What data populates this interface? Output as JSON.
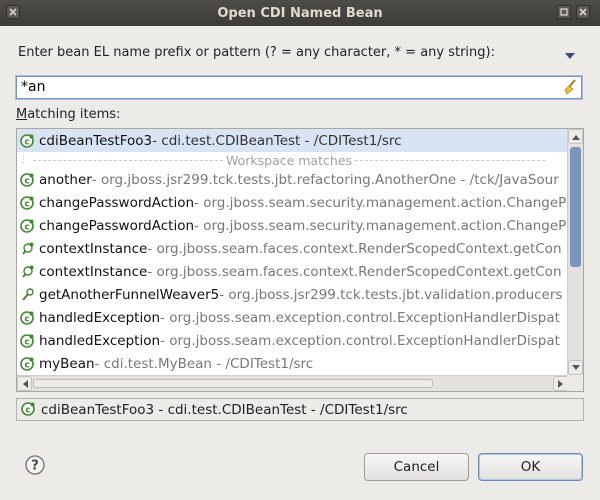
{
  "window": {
    "title": "Open CDI Named Bean"
  },
  "prompt": {
    "label": "Enter bean EL name prefix or pattern (? = any character, * = any string):"
  },
  "search": {
    "value": "*an"
  },
  "matching": {
    "mnemonic": "M",
    "label_rest": "atching items:"
  },
  "list": {
    "selected": {
      "name": "cdiBeanTestFoo3",
      "detail": " - cdi.test.CDIBeanTest - /CDITest1/src"
    },
    "separator": "Workspace matches",
    "items": [
      {
        "name": "another",
        "detail": " - org.jboss.jsr299.tck.tests.jbt.refactoring.AnotherOne - /tck/JavaSour"
      },
      {
        "name": "changePasswordAction",
        "detail": " - org.jboss.seam.security.management.action.ChangeP"
      },
      {
        "name": "changePasswordAction",
        "detail": " - org.jboss.seam.security.management.action.ChangeP"
      },
      {
        "name": "contextInstance",
        "detail": " - org.jboss.seam.faces.context.RenderScopedContext.getCon"
      },
      {
        "name": "contextInstance",
        "detail": " - org.jboss.seam.faces.context.RenderScopedContext.getCon"
      },
      {
        "name": "getAnotherFunnelWeaver5",
        "detail": " - org.jboss.jsr299.tck.tests.jbt.validation.producers"
      },
      {
        "name": "handledException",
        "detail": " - org.jboss.seam.exception.control.ExceptionHandlerDispat"
      },
      {
        "name": "handledException",
        "detail": " - org.jboss.seam.exception.control.ExceptionHandlerDispat"
      },
      {
        "name": "myBean",
        "detail": " - cdi.test.MyBean - /CDITest1/src"
      }
    ]
  },
  "status": {
    "text": "cdiBeanTestFoo3 - cdi.test.CDIBeanTest - /CDITest1/src"
  },
  "buttons": {
    "cancel": "Cancel",
    "ok": "OK"
  },
  "colors": {
    "accent": "#7d94bd",
    "selection": "#d8e4f4",
    "title_bar": "#3c3b37",
    "icon_green": "#3d8a2e"
  }
}
